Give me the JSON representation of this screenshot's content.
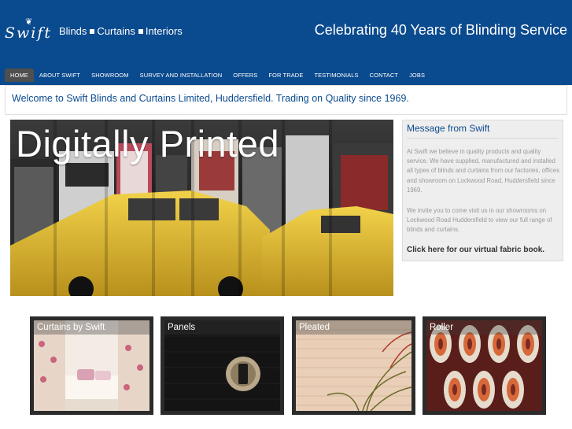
{
  "brand": {
    "name": "Swift",
    "tagline_parts": [
      "Blinds",
      "Curtains",
      "Interiors"
    ],
    "celebration": "Celebrating 40 Years of Blinding Service"
  },
  "nav": {
    "items": [
      "HOME",
      "ABOUT SWIFT",
      "SHOWROOM",
      "SURVEY AND INSTALLATION",
      "OFFERS",
      "FOR TRADE",
      "TESTIMONIALS",
      "CONTACT",
      "JOBS"
    ],
    "active": "HOME"
  },
  "welcome": "Welcome to Swift Blinds and Curtains Limited, Huddersfield. Trading on Quality since 1969.",
  "hero": {
    "title": "Digitally Printed"
  },
  "message": {
    "title": "Message from Swift",
    "paragraph1": "At Swift we believe in quality products and quality service. We have supplied, manufactured and installed all types of blinds and curtains from our factories, offices and showroom on Lockwood Road, Huddersfield since 1969.",
    "paragraph2": "We invite you to come visit us in our showrooms on Lockwood Road Huddersfield to view our full range of blinds and curtains.",
    "link": "Click here for our virtual fabric book."
  },
  "tiles": [
    {
      "label": "Curtains by Swift"
    },
    {
      "label": "Panels"
    },
    {
      "label": "Pleated"
    },
    {
      "label": "Roller"
    }
  ],
  "colors": {
    "brand_blue": "#0a4a8e",
    "nav_active": "#4f4f4f",
    "tile_frame": "#2b2b2b"
  }
}
